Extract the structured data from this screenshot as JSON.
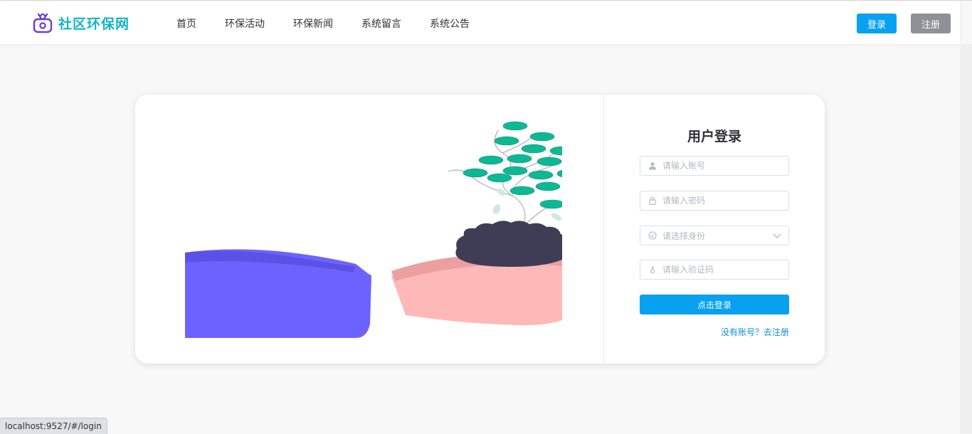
{
  "header": {
    "logo_text": "社区环保网",
    "nav": [
      "首页",
      "环保活动",
      "环保新闻",
      "系统留言",
      "系统公告"
    ],
    "login_label": "登录",
    "register_label": "注册"
  },
  "login_form": {
    "title": "用户登录",
    "account_placeholder": "请输入账号",
    "password_placeholder": "请输入密码",
    "role_placeholder": "请选择身份",
    "captcha_placeholder": "请输入验证码",
    "submit_label": "点击登录",
    "register_link": "没有账号？去注册"
  },
  "status_bar": {
    "url": "localhost:9527/#/login"
  },
  "colors": {
    "accent": "#07a1f0",
    "logo_text": "#13b5c1",
    "logo_icon": "#6a3fcf",
    "register_button": "#8e9196",
    "sleeve": "#6c63ff",
    "hand": "#ffb8b8",
    "soil": "#3f3d56",
    "leaf": "#0fb894"
  },
  "icons": {
    "logo": "fruit-basket-icon",
    "account": "user-icon",
    "password": "lock-icon",
    "role": "check-circle-icon",
    "captcha": "key-icon",
    "dropdown": "chevron-down-icon"
  }
}
